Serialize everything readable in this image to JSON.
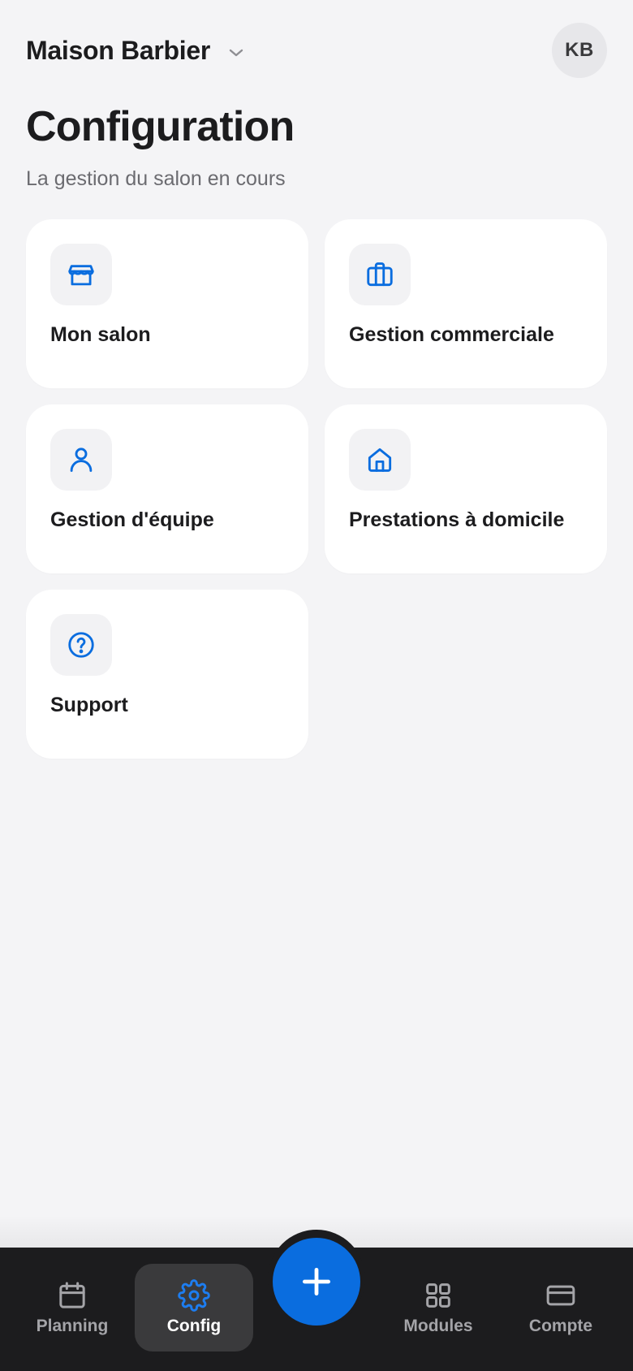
{
  "header": {
    "salon_name": "Maison Barbier",
    "avatar_initials": "KB"
  },
  "page": {
    "title": "Configuration",
    "subtitle": "La gestion du salon en cours"
  },
  "cards": [
    {
      "label": "Mon salon",
      "icon": "store-icon"
    },
    {
      "label": "Gestion commerciale",
      "icon": "briefcase-icon"
    },
    {
      "label": "Gestion d'équipe",
      "icon": "user-icon"
    },
    {
      "label": "Prestations à domicile",
      "icon": "home-icon"
    },
    {
      "label": "Support",
      "icon": "help-circle-icon"
    }
  ],
  "tabbar": {
    "tabs": [
      {
        "label": "Planning",
        "icon": "calendar-icon",
        "active": false
      },
      {
        "label": "Config",
        "icon": "gear-icon",
        "active": true
      },
      {
        "label": "Modules",
        "icon": "grid-icon",
        "active": false
      },
      {
        "label": "Compte",
        "icon": "credit-card-icon",
        "active": false
      }
    ],
    "fab_icon": "plus-icon"
  },
  "colors": {
    "accent": "#0a6ddf",
    "background": "#f4f4f6",
    "card": "#ffffff",
    "tabbar": "#1c1c1e",
    "tab_active_bg": "#3a3a3c",
    "tab_inactive": "#a4a4a8"
  }
}
